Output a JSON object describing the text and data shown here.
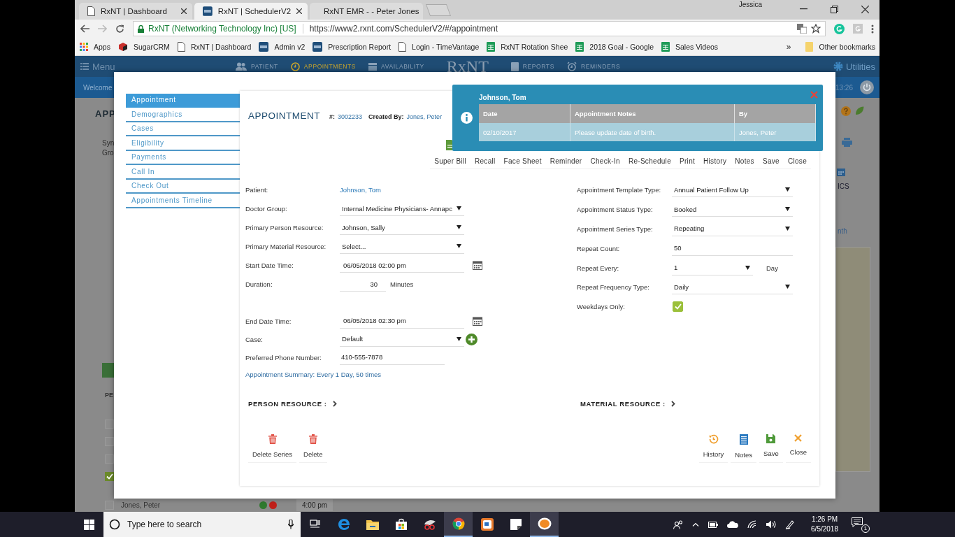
{
  "browser": {
    "tabs": [
      {
        "title": "RxNT | Dashboard",
        "selected": false
      },
      {
        "title": "RxNT | SchedulerV2",
        "selected": true
      },
      {
        "title": "RxNT EMR - - Peter Jones",
        "selected": false
      }
    ],
    "user": "Jessica",
    "site_identity": "RxNT (Networking Technology Inc) [US]",
    "url": "https://www2.rxnt.com/SchedulerV2/#/appointment",
    "bookmarks": [
      {
        "label": "Apps"
      },
      {
        "label": "SugarCRM"
      },
      {
        "label": "RxNT | Dashboard"
      },
      {
        "label": "Admin v2"
      },
      {
        "label": "Prescription Report"
      },
      {
        "label": "Login - TimeVantage"
      },
      {
        "label": "RxNT Rotation Shee"
      },
      {
        "label": "2018 Goal - Google"
      },
      {
        "label": "Sales Videos"
      }
    ],
    "overflow": "»",
    "other_bookmarks": "Other bookmarks"
  },
  "app_header": {
    "menu": "Menu",
    "nav": [
      {
        "label": "PATIENT",
        "selected": false
      },
      {
        "label": "APPOINTMENTS",
        "selected": true
      },
      {
        "label": "AVAILABILITY",
        "selected": false
      },
      {
        "label": "REPORTS",
        "selected": false
      },
      {
        "label": "REMINDERS",
        "selected": false
      }
    ],
    "logo": "RxNT",
    "utilities": "Utilities",
    "welcome": "Welcome",
    "time": "13:26"
  },
  "background": {
    "heading": "APP",
    "lines": [
      "Syn",
      "Gro"
    ],
    "section": "PE",
    "checkboxes": [
      {
        "checked": false
      },
      {
        "checked": false
      },
      {
        "checked": false
      },
      {
        "checked": true
      }
    ],
    "side_labels": [
      "ICS",
      "nth"
    ],
    "bottom_row": {
      "checked": false,
      "name": "Jones, Peter",
      "time": "4:00 pm",
      "dots": [
        {
          "color": "#2f7a2f"
        },
        {
          "color": "#c0201a"
        }
      ]
    }
  },
  "modal": {
    "nav": [
      {
        "label": "Appointment",
        "selected": true
      },
      {
        "label": "Demographics",
        "selected": false
      },
      {
        "label": "Cases",
        "selected": false
      },
      {
        "label": "Eligibility",
        "selected": false
      },
      {
        "label": "Payments",
        "selected": false
      },
      {
        "label": "Call In",
        "selected": false
      },
      {
        "label": "Check Out",
        "selected": false
      },
      {
        "label": "Appointments Timeline",
        "selected": false
      }
    ],
    "title": "APPOINTMENT",
    "number_label": "#:",
    "number": "3002233",
    "created_by_label": "Created By:",
    "created_by": "Jones, Peter",
    "toolbar": [
      "Super Bill",
      "Recall",
      "Face Sheet",
      "Reminder",
      "Check-In",
      "Re-Schedule",
      "Print",
      "History",
      "Notes",
      "Save",
      "Close"
    ],
    "left_groups": [
      [
        {
          "label": "Patient:",
          "value": "Johnson, Tom",
          "kind": "link"
        },
        {
          "label": "Doctor Group:",
          "value": "Internal Medicine Physicians- Annapc",
          "kind": "select"
        },
        {
          "label": "Primary Person Resource:",
          "value": "Johnson, Sally",
          "kind": "select"
        },
        {
          "label": "Primary Material Resource:",
          "value": "Select...",
          "kind": "select"
        },
        {
          "label": "Start Date Time:",
          "value": "06/05/2018 02:00 pm",
          "kind": "date"
        },
        {
          "label": "Duration:",
          "value": "30",
          "kind": "number",
          "suffix": "Minutes"
        }
      ],
      [
        {
          "label": "End Date Time:",
          "value": "06/05/2018 02:30 pm",
          "kind": "date"
        },
        {
          "label": "Case:",
          "value": "Default",
          "kind": "select_add"
        },
        {
          "label": "Preferred Phone Number:",
          "value": "410-555-7878",
          "kind": "text"
        }
      ]
    ],
    "summary": "Appointment Summary: Every 1 Day, 50 times",
    "right_fields": [
      {
        "label": "Appointment Template Type:",
        "value": "Annual Patient Follow Up",
        "kind": "select"
      },
      {
        "label": "Appointment Status Type:",
        "value": "Booked",
        "kind": "select"
      },
      {
        "label": "Appointment Series Type:",
        "value": "Repeating",
        "kind": "select"
      },
      {
        "label": "Repeat Count:",
        "value": "50",
        "kind": "text"
      },
      {
        "label": "Repeat Every:",
        "value": "1",
        "kind": "short_select",
        "suffix": "Day"
      },
      {
        "label": "Repeat Frequency Type:",
        "value": "Daily",
        "kind": "select"
      },
      {
        "label": "Weekdays Only:",
        "kind": "checkbox",
        "checked": true
      }
    ],
    "sections": [
      "PERSON RESOURCE :",
      "MATERIAL RESOURCE :"
    ],
    "left_actions": [
      "Delete Series",
      "Delete"
    ],
    "right_actions": [
      "History",
      "Notes",
      "Save",
      "Close"
    ]
  },
  "notes_popup": {
    "patient": "Johnson, Tom",
    "columns": [
      "Date",
      "Appointment Notes",
      "By"
    ],
    "rows": [
      [
        "02/10/2017",
        "Please update date of birth.",
        "Jones, Peter"
      ]
    ]
  },
  "taskbar": {
    "search_placeholder": "Type here to search",
    "apps": [
      {
        "selected": false
      },
      {
        "selected": false
      },
      {
        "selected": false
      },
      {
        "selected": false
      },
      {
        "selected": false
      },
      {
        "selected": true
      },
      {
        "selected": false
      },
      {
        "selected": false
      },
      {
        "selected": true
      }
    ],
    "time": "1:26 PM",
    "date": "6/5/2018",
    "notification_count": "1"
  }
}
